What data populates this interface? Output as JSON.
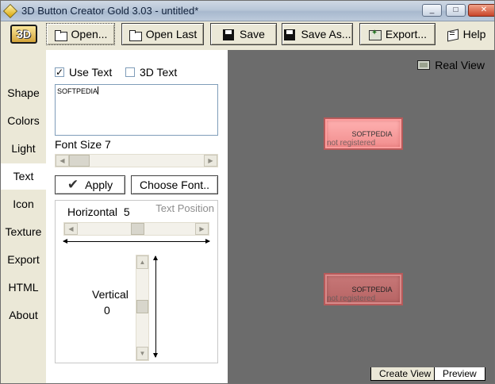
{
  "window": {
    "title": "3D Button Creator Gold 3.03 - untitled*",
    "controls": [
      "_",
      "□",
      "✕"
    ]
  },
  "toolbar": {
    "logo": "3D",
    "open": "Open...",
    "open_last": "Open Last",
    "save": "Save",
    "save_as": "Save As...",
    "export": "Export...",
    "help": "Help"
  },
  "nav": {
    "items": [
      "Shape",
      "Colors",
      "Light",
      "Text",
      "Icon",
      "Texture",
      "Export",
      "HTML",
      "About"
    ],
    "active": "Text"
  },
  "panel": {
    "use_text_label": "Use Text",
    "use_text_checked": true,
    "text_3d_label": "3D Text",
    "text_3d_checked": false,
    "text_value": "SOFTPEDIA",
    "font_size_label": "Font Size",
    "font_size_value": "7",
    "apply_label": "Apply",
    "choose_font_label": "Choose Font..",
    "text_position_label": "Text Position",
    "horizontal_label": "Horizontal",
    "horizontal_value": "5",
    "vertical_label": "Vertical",
    "vertical_value": "0"
  },
  "preview": {
    "real_view_label": "Real View",
    "button_text": "SOFTPEDIA",
    "watermark": "not registered",
    "colors": {
      "normal": "#f48f8f",
      "pressed": "#bb6a6a",
      "canvas": "#6c6c6c"
    }
  },
  "tabs": {
    "create_view": "Create View",
    "preview": "Preview"
  }
}
